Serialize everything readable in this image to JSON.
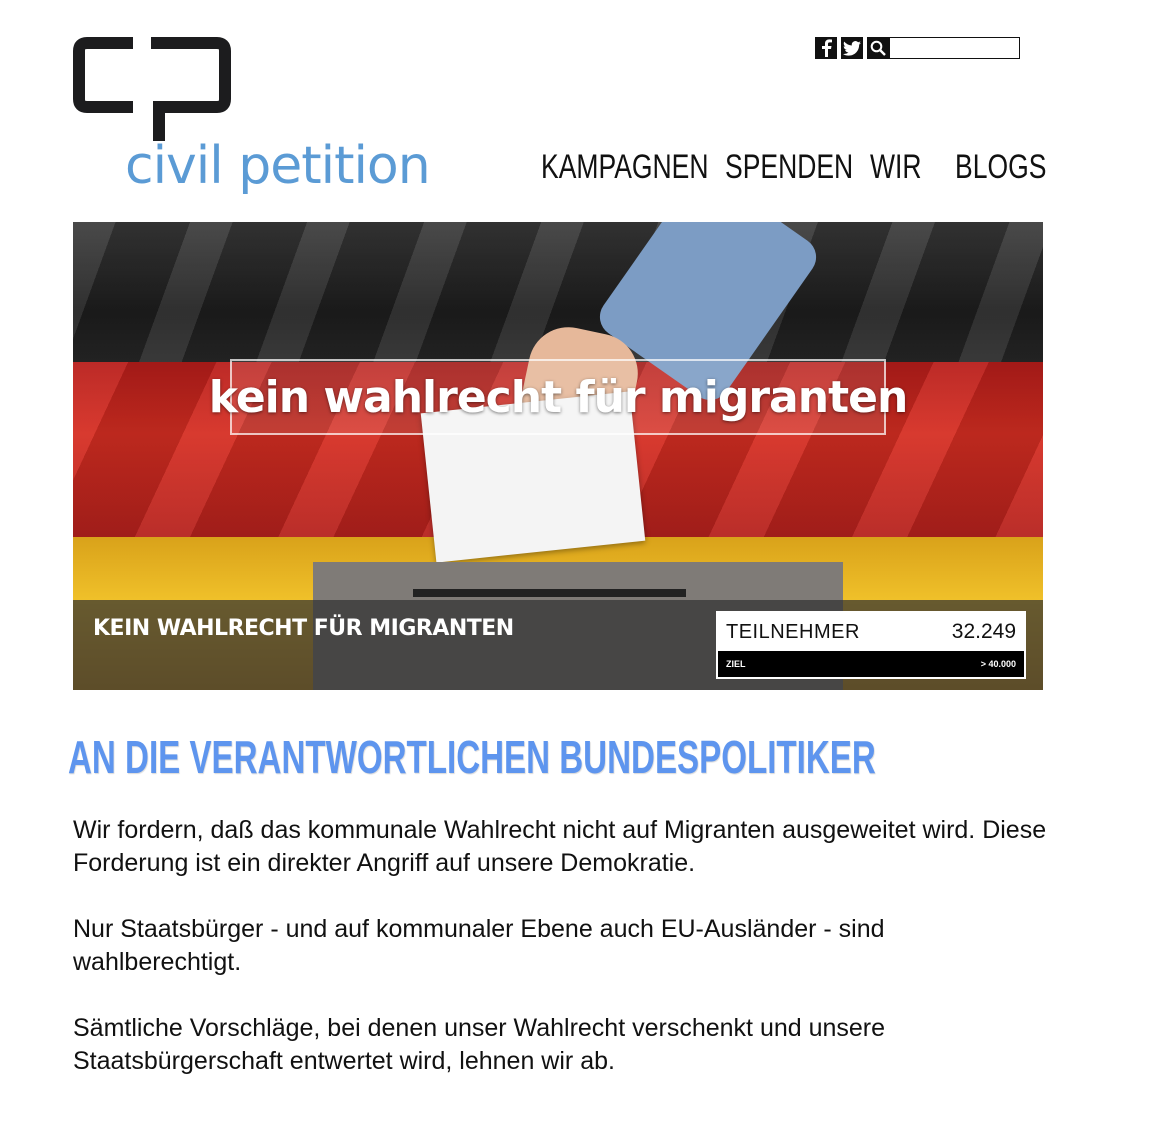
{
  "logo": {
    "text": "civil petition",
    "mark_icon": "speech-bubble-logo-icon"
  },
  "social": {
    "facebook_icon": "facebook-icon",
    "twitter_icon": "twitter-icon",
    "search_icon": "search-icon",
    "search_value": ""
  },
  "nav": {
    "items": [
      "KAMPAGNEN",
      "SPENDEN",
      "WIR",
      "BLOGS"
    ]
  },
  "hero": {
    "title": "kein wahlrecht für migranten",
    "caption": "KEIN WAHLRECHT FÜR MIGRANTEN",
    "counter": {
      "label": "TEILNEHMER",
      "value": "32.249",
      "goal_label": "ZIEL",
      "goal_value": "> 40.000"
    }
  },
  "addressee": "AN DIE VERANTWORTLICHEN BUNDESPOLITIKER",
  "body": {
    "paragraphs": [
      "Wir fordern, daß das kommunale Wahlrecht nicht auf Migranten ausgeweitet wird. Diese Forderung ist ein direkter Angriff auf unsere Demokratie.",
      "Nur Staatsbürger - und auf kommunaler Ebene auch EU-Ausländer - sind wahlberechtigt.",
      "Sämtliche Vorschläge, bei denen unser Wahlrecht verschenkt und unsere Staatsbürgerschaft entwertet wird, lehnen wir ab."
    ]
  },
  "colors": {
    "brand_blue": "#5b9bd5",
    "heading_blue": "#5e95ee"
  }
}
